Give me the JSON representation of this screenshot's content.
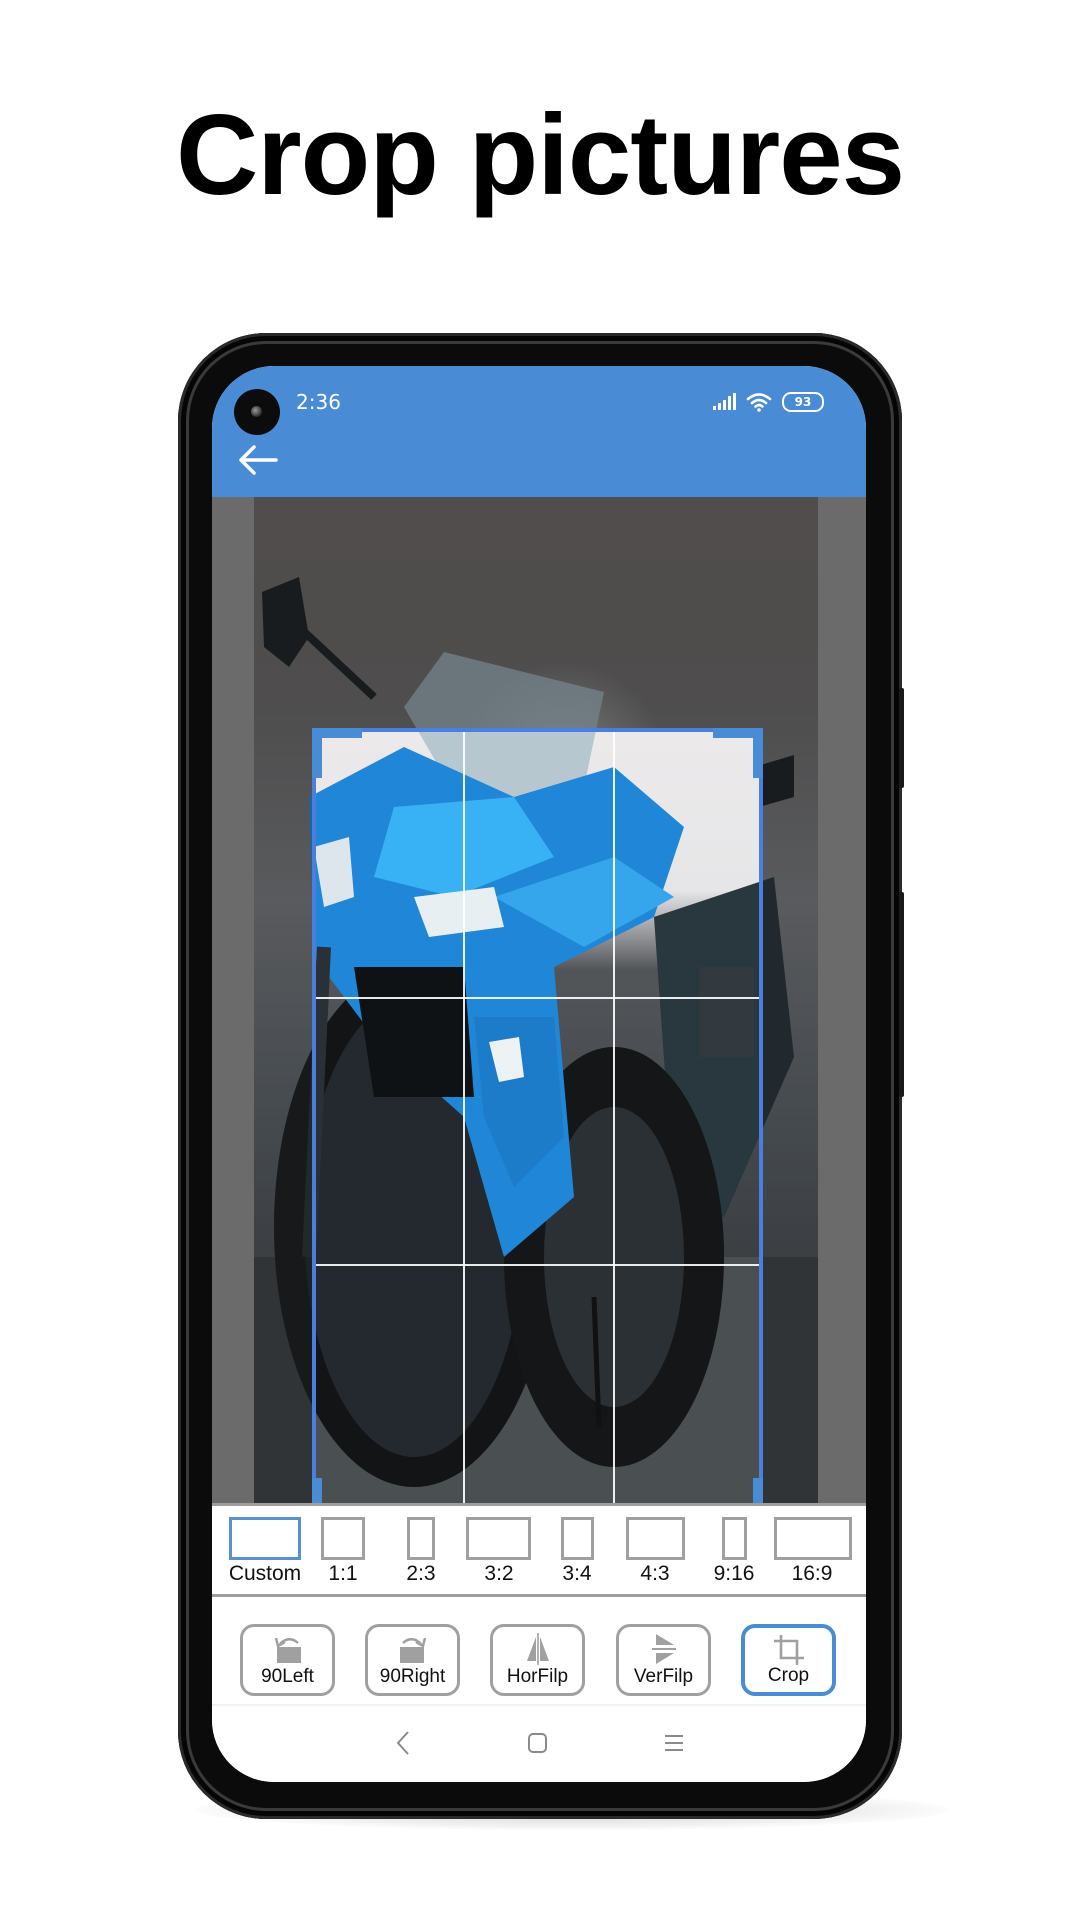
{
  "promo": {
    "title": "Crop pictures"
  },
  "status_bar": {
    "time": "2:36",
    "battery": "93",
    "icons": [
      "signal-icon",
      "wifi-icon",
      "battery-icon"
    ]
  },
  "header": {
    "back_icon": "arrow-left-icon",
    "color": "#4A8BD6"
  },
  "crop": {
    "accent_color": "#4A7FE0",
    "grid": "rule-of-thirds"
  },
  "ratios": {
    "selected": "Custom",
    "items": [
      {
        "label": "Custom"
      },
      {
        "label": "1:1"
      },
      {
        "label": "2:3"
      },
      {
        "label": "3:2"
      },
      {
        "label": "3:4"
      },
      {
        "label": "4:3"
      },
      {
        "label": "9:16"
      },
      {
        "label": "16:9"
      }
    ]
  },
  "tools": {
    "selected": "Crop",
    "items": [
      {
        "label": "90Left",
        "icon": "rotate-left-icon"
      },
      {
        "label": "90Right",
        "icon": "rotate-right-icon"
      },
      {
        "label": "HorFilp",
        "icon": "flip-horizontal-icon"
      },
      {
        "label": "VerFilp",
        "icon": "flip-vertical-icon"
      },
      {
        "label": "Crop",
        "icon": "crop-icon"
      }
    ]
  },
  "navigation": {
    "icons": [
      "nav-back-icon",
      "nav-home-icon",
      "nav-recents-icon"
    ]
  }
}
